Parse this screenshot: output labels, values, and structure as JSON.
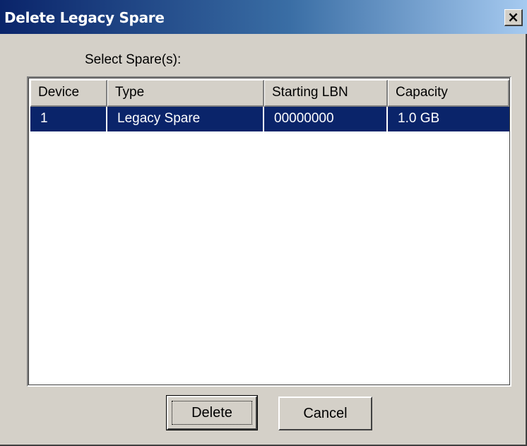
{
  "window": {
    "title": "Delete Legacy Spare",
    "close_glyph": "×"
  },
  "prompt": {
    "label": "Select Spare(s):"
  },
  "table": {
    "columns": [
      "Device",
      "Type",
      "Starting LBN",
      "Capacity"
    ],
    "rows": [
      {
        "device": "1",
        "type": "Legacy Spare",
        "starting_lbn": "00000000",
        "capacity": "1.0 GB",
        "selected": true
      }
    ]
  },
  "buttons": {
    "delete_label": "Delete",
    "cancel_label": "Cancel"
  },
  "colors": {
    "selection": "#0a246a",
    "dialog_face": "#d4d0c8"
  }
}
